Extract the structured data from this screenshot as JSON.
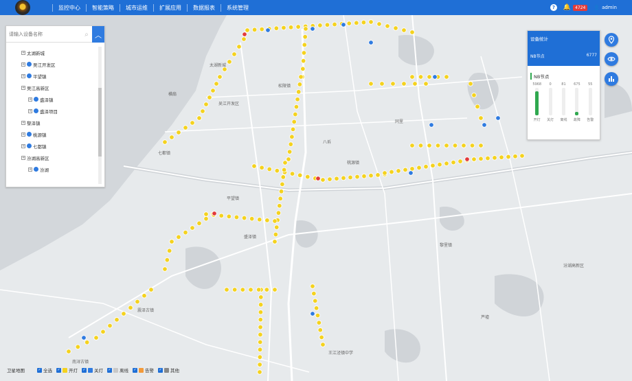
{
  "nav": {
    "items": [
      "监控中心",
      "智能策略",
      "城市运维",
      "扩展应用",
      "数据报表",
      "系统管理"
    ]
  },
  "header": {
    "help_icon": "question-icon",
    "alert_count": "4724",
    "user": "admin"
  },
  "search": {
    "placeholder": "请输入设备名称"
  },
  "tree": {
    "items": [
      {
        "label": "太湖新城",
        "level": 1,
        "node": false
      },
      {
        "label": "吴江开发区",
        "level": 1,
        "node": true
      },
      {
        "label": "平望镇",
        "level": 1,
        "node": true
      },
      {
        "label": "吴江高新区",
        "level": 1,
        "node": false
      },
      {
        "label": "盛泽镇",
        "level": 2,
        "node": true
      },
      {
        "label": "盛泽项目",
        "level": 2,
        "node": true
      },
      {
        "label": "黎泽镇",
        "level": 1,
        "node": false
      },
      {
        "label": "桃源镇",
        "level": 1,
        "node": true
      },
      {
        "label": "七都镇",
        "level": 1,
        "node": true
      },
      {
        "label": "汾湖高新区",
        "level": 1,
        "node": false
      },
      {
        "label": "汾湖",
        "level": 2,
        "node": true
      }
    ]
  },
  "stats": {
    "title": "设备统计",
    "nb_label": "NB节点",
    "nb_count": "6777",
    "section_title": "NB节点",
    "bars": [
      {
        "label": "开灯",
        "value": "5968",
        "fraction": 0.88,
        "color": "#2fa84f"
      },
      {
        "label": "关灯",
        "value": "0",
        "fraction": 0.0,
        "color": "#2fa84f"
      },
      {
        "label": "离线",
        "value": "81",
        "fraction": 0.0,
        "color": "#2fa84f"
      },
      {
        "label": "故障",
        "value": "675",
        "fraction": 0.12,
        "color": "#2fa84f"
      },
      {
        "label": "告警",
        "value": "55",
        "fraction": 0.0,
        "color": "#2fa84f"
      }
    ]
  },
  "legend": {
    "basemap": "卫星地图",
    "items": [
      {
        "label": "全选",
        "checked": true,
        "color": "#1f6fd6"
      },
      {
        "label": "开灯",
        "checked": true,
        "color": "#f4d21f"
      },
      {
        "label": "关灯",
        "checked": true,
        "color": "#2f7be0"
      },
      {
        "label": "离线",
        "checked": true,
        "color": "#c8c8c8"
      },
      {
        "label": "告警",
        "checked": true,
        "color": "#f39a3a"
      },
      {
        "label": "其他",
        "checked": true,
        "color": "#888888"
      }
    ]
  },
  "colors": {
    "primary": "#1f6fd6",
    "on": "#f4d21f",
    "off": "#2f7be0",
    "fault": "#e23b3b"
  },
  "map_labels": [
    "太湖新城",
    "吴江开发区",
    "松陵镇",
    "平望镇",
    "盛泽镇",
    "七都镇",
    "桃源镇",
    "汾湖高新区",
    "黎里镇",
    "南浔古镇",
    "王江泾镇中学",
    "震泽古镇",
    "同里",
    "横扇",
    "八坼",
    "芦墟"
  ]
}
